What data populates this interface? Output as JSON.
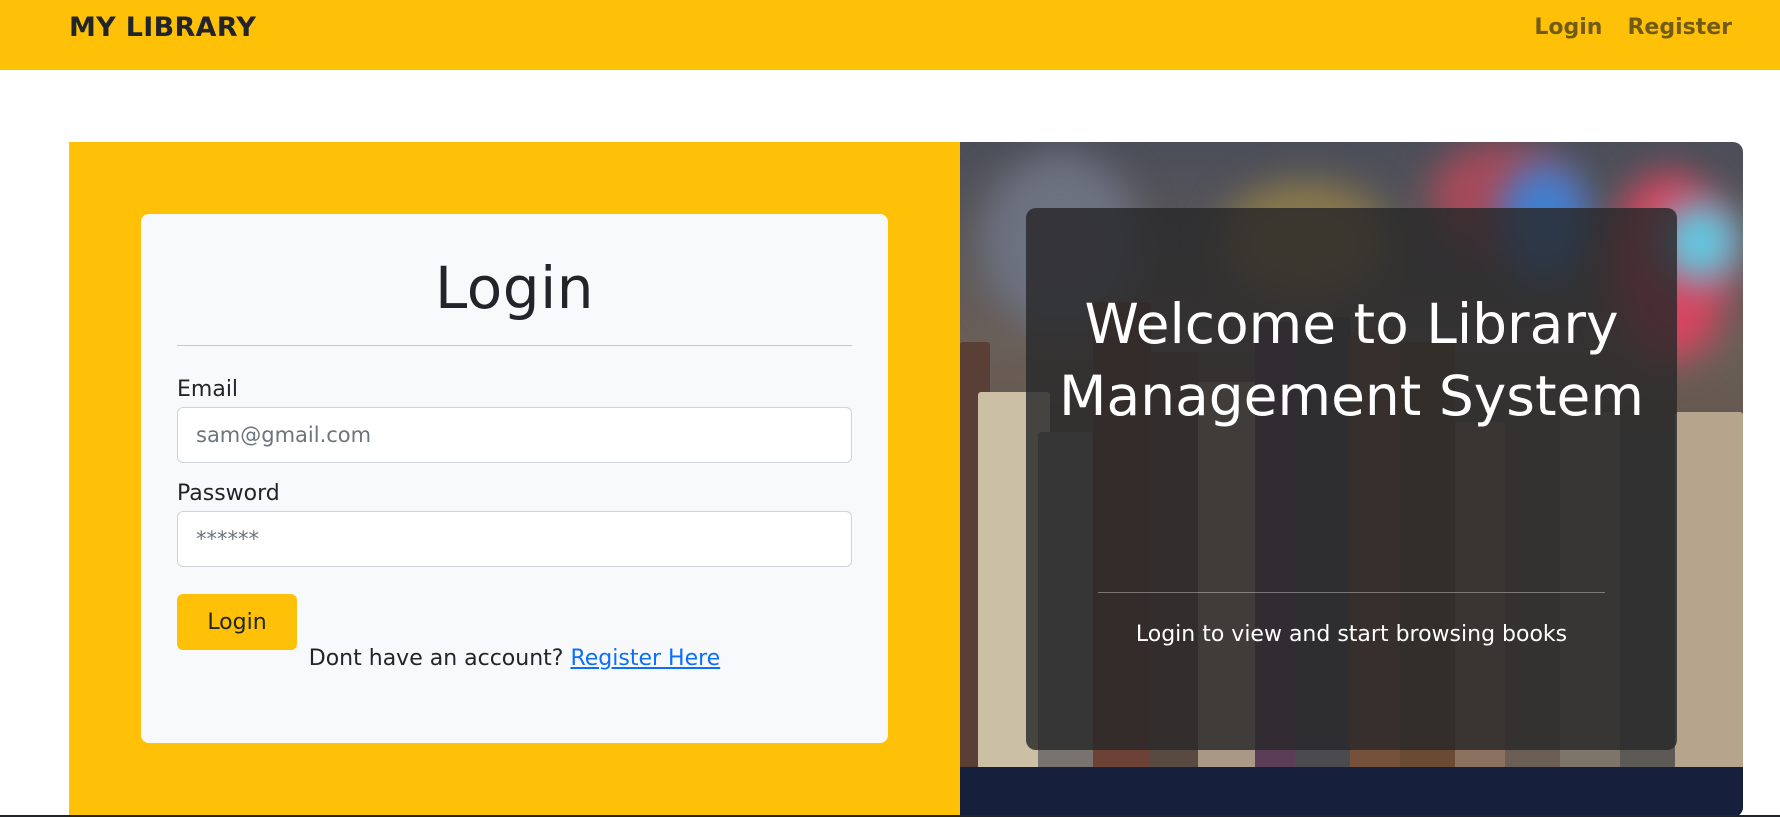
{
  "navbar": {
    "brand": "MY LIBRARY",
    "links": [
      {
        "label": "Login"
      },
      {
        "label": "Register"
      }
    ]
  },
  "login_card": {
    "title": "Login",
    "email_label": "Email",
    "email_placeholder": "sam@gmail.com",
    "password_label": "Password",
    "password_placeholder": "******",
    "submit_label": "Login",
    "register_prompt": "Dont have an account?",
    "register_link": "Register Here"
  },
  "hero": {
    "title": "Welcome to Library Management System",
    "subtitle": "Login to view and start browsing books"
  },
  "colors": {
    "accent": "#ffc107",
    "card_bg": "#f8f9fa",
    "link": "#0d6efd",
    "text": "#212529"
  }
}
